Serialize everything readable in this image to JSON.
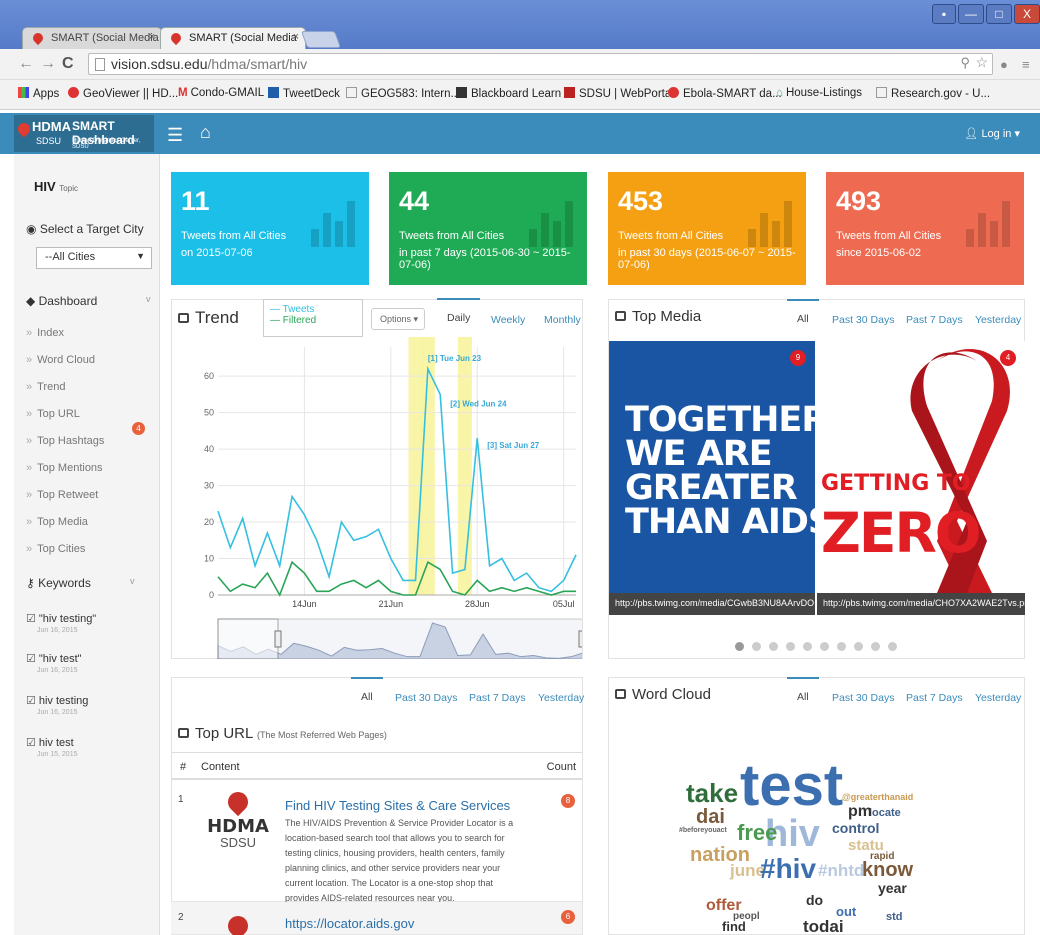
{
  "browser": {
    "tabs": [
      "SMART (Social Media",
      "SMART (Social Media"
    ],
    "tab_close": "×",
    "url_host": "vision.sdsu.edu",
    "url_path": "/hdma/smart/hiv",
    "bookmarks": [
      "Apps",
      "GeoViewer || HD...",
      "Condo-GMAIL",
      "TweetDeck",
      "GEOG583: Intern...",
      "Blackboard Learn",
      "SDSU | WebPortal",
      "Ebola-SMART da...",
      "House-Listings",
      "Research.gov - U..."
    ]
  },
  "header": {
    "logo_hdma": "HDMA",
    "logo_sdsu": "SDSU",
    "logo_smart": "SMART Dashboard",
    "logo_sub": "Human Dynamics Center, SDSU",
    "login": "Log in"
  },
  "sidebar": {
    "topic": "HIV",
    "topic_small": "Topic",
    "select_city_label": "Select a Target City",
    "city_value": "--All Cities",
    "dashboard_label": "Dashboard",
    "nav_items": [
      "Index",
      "Word Cloud",
      "Trend",
      "Top URL",
      "Top Hashtags",
      "Top Mentions",
      "Top Retweet",
      "Top Media",
      "Top Cities"
    ],
    "keywords_label": "Keywords",
    "keywords_count": "4",
    "keywords": [
      {
        "label": "\"hiv testing\"",
        "date": "Jun 16, 2015"
      },
      {
        "label": "\"hiv test\"",
        "date": "Jun 16, 2015"
      },
      {
        "label": "hiv testing",
        "date": "Jun 16, 2015"
      },
      {
        "label": "hiv test",
        "date": "Jun 15, 2015"
      }
    ]
  },
  "cards": [
    {
      "num": "11",
      "l1": "Tweets from All Cities",
      "l2": "on 2015-07-06",
      "color": "#1bbfe8"
    },
    {
      "num": "44",
      "l1": "Tweets from All Cities",
      "l2": "in past 7 days (2015-06-30 ~ 2015-07-06)",
      "color": "#1fab55"
    },
    {
      "num": "453",
      "l1": "Tweets from All Cities",
      "l2": "in past 30 days (2015-06-07 ~ 2015-07-06)",
      "color": "#f4a012"
    },
    {
      "num": "493",
      "l1": "Tweets from All Cities",
      "l2": "since 2015-06-02",
      "color": "#ee6a50"
    }
  ],
  "trend": {
    "title": "Trend",
    "legend": [
      "Tweets",
      "Filtered"
    ],
    "options": "Options",
    "tabs": [
      "Daily",
      "Weekly",
      "Monthly"
    ],
    "flags": [
      "[1] Tue Jun 23",
      "[2] Wed Jun 24",
      "[3] Sat Jun 27"
    ]
  },
  "chart_data": {
    "type": "line",
    "x": [
      "Jun 7",
      "Jun 8",
      "Jun 9",
      "Jun 10",
      "Jun 11",
      "Jun 12",
      "Jun 13",
      "Jun 14",
      "Jun 15",
      "Jun 16",
      "Jun 17",
      "Jun 18",
      "Jun 19",
      "Jun 20",
      "Jun 21",
      "Jun 22",
      "Jun 23",
      "Jun 24",
      "Jun 25",
      "Jun 26",
      "Jun 27",
      "Jun 28",
      "Jun 29",
      "Jun 30",
      "Jul 1",
      "Jul 2",
      "Jul 3",
      "Jul 4",
      "Jul 5",
      "Jul 6"
    ],
    "series": [
      {
        "name": "Tweets",
        "values": [
          23,
          13,
          21,
          8,
          17,
          8,
          27,
          22,
          15,
          5,
          20,
          15,
          16,
          18,
          10,
          4,
          4,
          62,
          55,
          6,
          7,
          43,
          8,
          10,
          4,
          6,
          2,
          1,
          4,
          11
        ]
      },
      {
        "name": "Filtered",
        "values": [
          5,
          1,
          3,
          2,
          6,
          0,
          9,
          6,
          1,
          1,
          3,
          4,
          2,
          4,
          1,
          0,
          0,
          9,
          7,
          1,
          0,
          4,
          1,
          2,
          1,
          2,
          1,
          0,
          1,
          1
        ]
      }
    ],
    "xticks": [
      "14Jun",
      "21Jun",
      "28Jun",
      "05Jul"
    ],
    "yticks": [
      "0",
      "10",
      "20",
      "30",
      "40",
      "50",
      "60"
    ],
    "ylim": [
      0,
      68
    ],
    "highlight_days": [
      "Jun 23",
      "Jun 24",
      "Jun 27"
    ],
    "colors": {
      "Tweets": "#35c0e0",
      "Filtered": "#2aa457"
    }
  },
  "media": {
    "title": "Top Media",
    "tabs": [
      "All",
      "Past 30 Days",
      "Past 7 Days",
      "Yesterday"
    ],
    "items": [
      {
        "text": "TOGETHER\nWE ARE\nGREATER\nTHAN AIDS.",
        "caption": "http://pbs.twimg.com/media/CGwbB3NU8AArvDO.",
        "count": "9"
      },
      {
        "text1": "GETTING TO",
        "text2": "ZERO",
        "caption": "http://pbs.twimg.com/media/CHO7XA2WAE2Tvs.pr",
        "count": "4"
      }
    ]
  },
  "url_panel": {
    "tabs": [
      "All",
      "Past 30 Days",
      "Past 7 Days",
      "Yesterday"
    ],
    "title": "Top URL",
    "subtitle": "(The Most Referred Web Pages)",
    "col_hash": "#",
    "col_content": "Content",
    "col_count": "Count",
    "rows": [
      {
        "idx": "1",
        "title": "Find HIV Testing Sites & Care Services",
        "desc": "The HIV/AIDS Prevention & Service Provider Locator is a location-based search tool that allows you to search for testing clinics, housing providers, health centers, family planning clinics, and other service providers near your current location. The Locator is a one-stop shop that provides AIDS-related resources near you.",
        "count": "8",
        "logo1": "HDMA",
        "logo2": "SDSU"
      },
      {
        "idx": "2",
        "title": "https://locator.aids.gov",
        "count": "6"
      }
    ]
  },
  "wordcloud": {
    "title": "Word Cloud",
    "tabs": [
      "All",
      "Past 30 Days",
      "Past 7 Days",
      "Yesterday"
    ],
    "words": [
      "test",
      "hiv",
      "take",
      "dai",
      "free",
      "nation",
      "june",
      "#hiv",
      "#nhtd",
      "know",
      "control",
      "locate",
      "pm",
      "statu",
      "year",
      "offer",
      "peopl",
      "find",
      "todai",
      "out",
      "do",
      "std",
      "rapid",
      "#beforeyouact",
      "@greaterthanaid"
    ]
  }
}
